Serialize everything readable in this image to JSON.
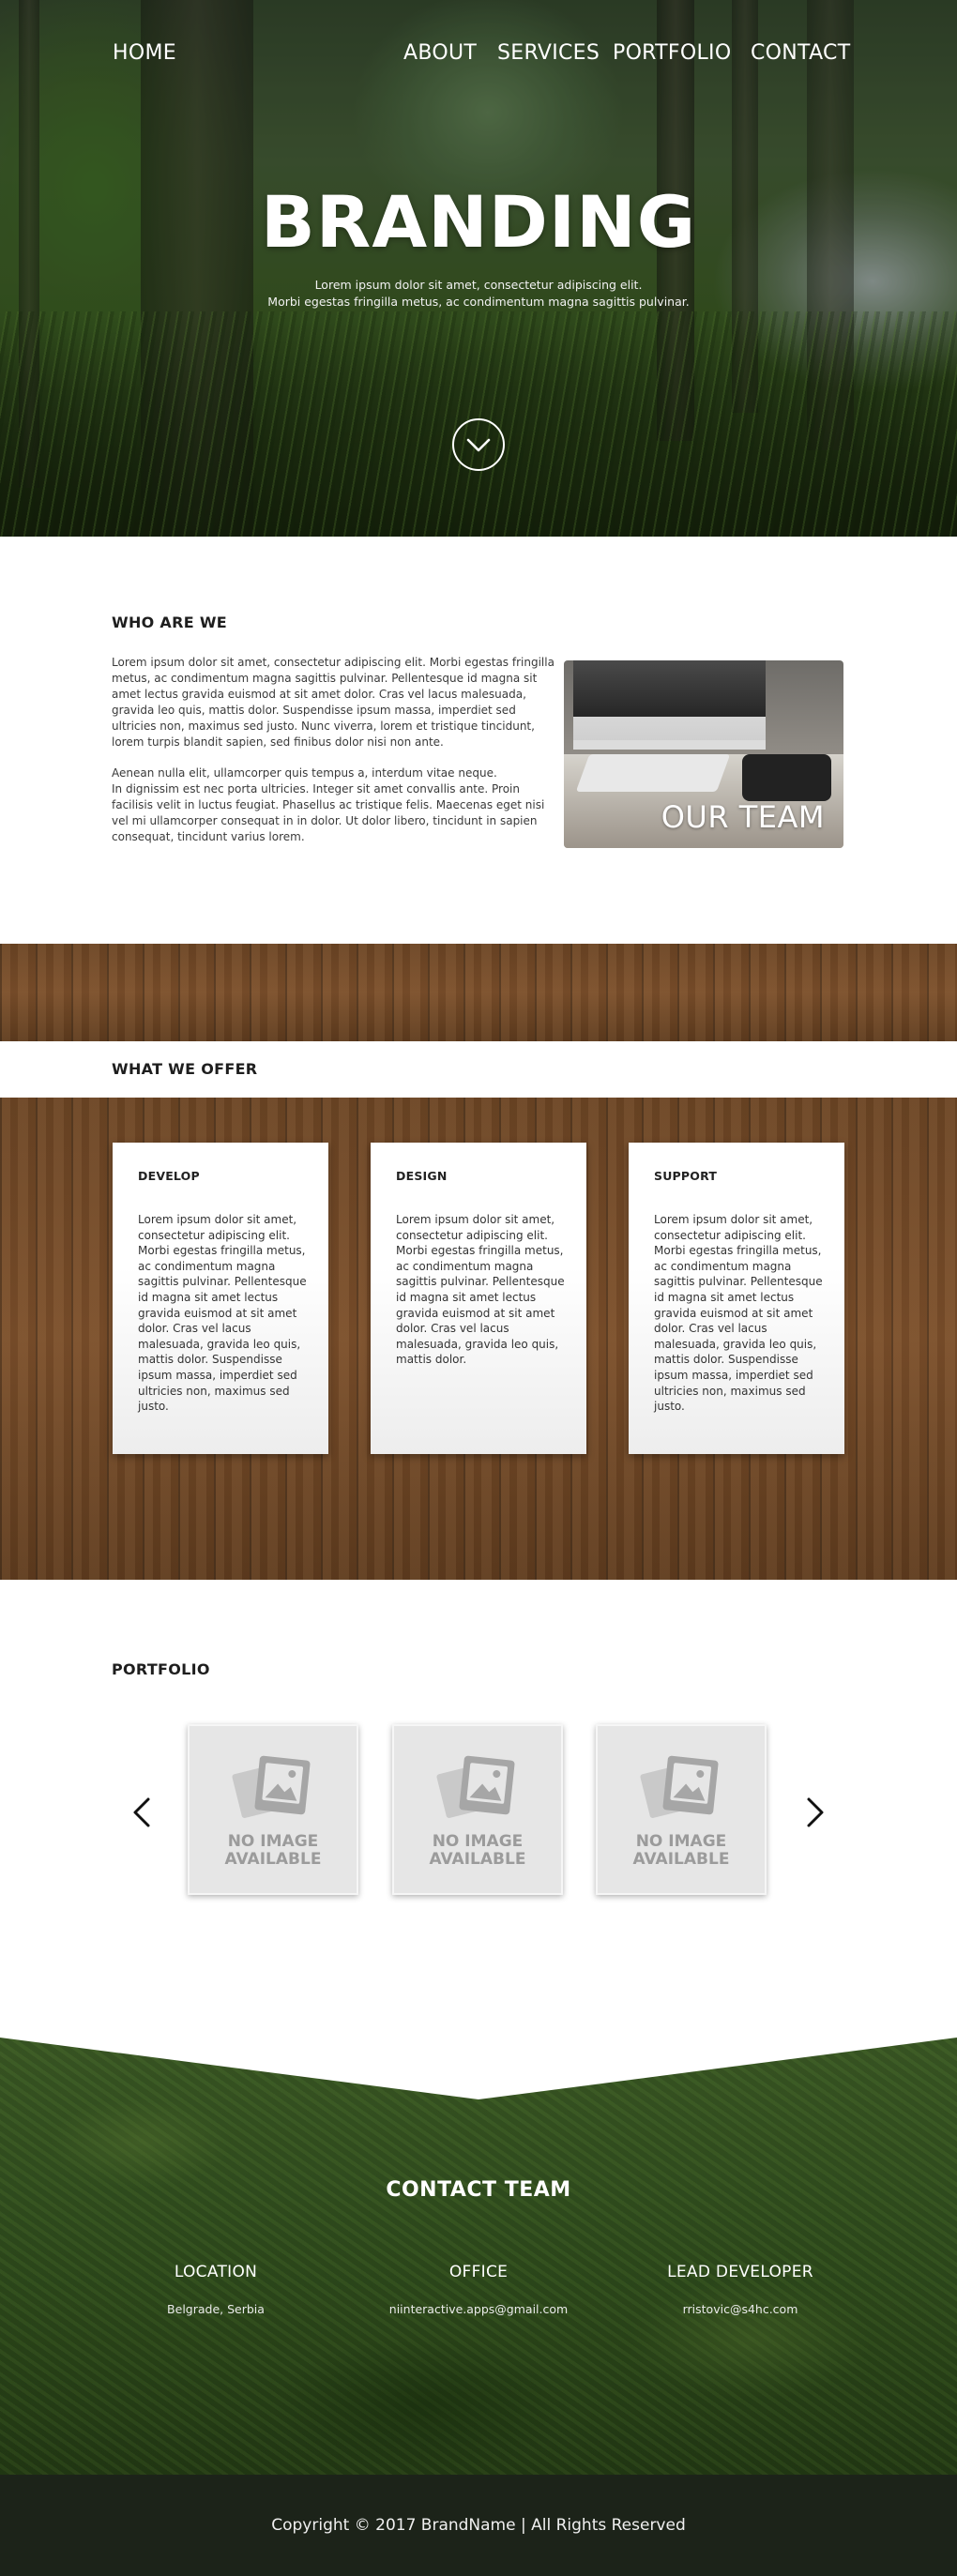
{
  "nav": {
    "home": "HOME",
    "about": "ABOUT",
    "services": "SERVICES",
    "portfolio": "PORTFOLIO",
    "contact": "CONTACT"
  },
  "hero": {
    "title": "BRANDING",
    "subtitle_line1": "Lorem ipsum dolor sit amet, consectetur adipiscing elit.",
    "subtitle_line2": "Morbi egestas fringilla metus, ac condimentum magna sagittis pulvinar.",
    "scroll_icon": "chevron-down-circle-icon"
  },
  "who": {
    "heading": "WHO ARE WE",
    "para1": "Lorem ipsum dolor sit amet, consectetur adipiscing elit. Morbi egestas fringilla\n metus, ac condimentum magna sagittis pulvinar. Pellentesque id magna sit\namet lectus gravida euismod at sit amet dolor. Cras vel lacus malesuada,\ngravida leo quis, mattis dolor. Suspendisse ipsum massa, imperdiet sed\nultricies non, maximus sed justo. Nunc viverra, lorem et tristique tincidunt,\nlorem turpis blandit sapien, sed finibus dolor nisi non ante.",
    "para2": "Aenean nulla elit, ullamcorper quis tempus a, interdum vitae neque.\nIn dignissim est nec porta ultricies. Integer sit amet convallis ante. Proin\nfacilisis velit in luctus feugiat. Phasellus ac tristique felis. Maecenas eget nisi\nvel mi ullamcorper consequat in in dolor. Ut dolor libero, tincidunt in sapien\nconsequat, tincidunt varius lorem.",
    "team_label": "OUR TEAM"
  },
  "offer": {
    "heading": "WHAT WE OFFER",
    "cards": [
      {
        "title": "DEVELOP",
        "body": "Lorem ipsum dolor sit amet, consectetur adipiscing elit. Morbi egestas fringilla metus, ac condimentum magna sagittis pulvinar. Pellentesque id magna sit amet lectus gravida euismod at sit amet dolor. Cras vel lacus malesuada, gravida leo quis, mattis dolor. Suspendisse ipsum massa, imperdiet sed ultricies non, maximus sed justo."
      },
      {
        "title": "DESIGN",
        "body": "Lorem ipsum dolor sit amet, consectetur adipiscing elit. Morbi egestas fringilla metus, ac condimentum magna sagittis pulvinar. Pellentesque id magna sit amet lectus gravida euismod at sit amet dolor. Cras vel lacus malesuada, gravida leo quis, mattis dolor."
      },
      {
        "title": "SUPPORT",
        "body": "Lorem ipsum dolor sit amet, consectetur adipiscing elit. Morbi egestas fringilla metus, ac condimentum magna sagittis pulvinar. Pellentesque id magna sit amet lectus gravida euismod at sit amet dolor. Cras vel lacus malesuada, gravida leo quis, mattis dolor. Suspendisse ipsum massa, imperdiet sed ultricies non, maximus sed justo."
      }
    ]
  },
  "portfolio": {
    "heading": "PORTFOLIO",
    "items": [
      {
        "label": "NO IMAGE\nAVAILABLE"
      },
      {
        "label": "NO IMAGE\nAVAILABLE"
      },
      {
        "label": "NO IMAGE\nAVAILABLE"
      }
    ],
    "prev_icon": "chevron-left-icon",
    "next_icon": "chevron-right-icon"
  },
  "contact": {
    "heading": "CONTACT TEAM",
    "columns": [
      {
        "label": "LOCATION",
        "value": "Belgrade, Serbia"
      },
      {
        "label": "OFFICE",
        "value": "niinteractive.apps@gmail.com"
      },
      {
        "label": "LEAD DEVELOPER",
        "value": "rristovic@s4hc.com"
      }
    ]
  },
  "footer": {
    "copyright": "Copyright © 2017 BrandName | All Rights Reserved"
  },
  "colors": {
    "forest_green": "#3b5a25",
    "wood_brown": "#6b4424",
    "footer_dark": "#1c2319",
    "text_dark": "#2a2a2a"
  }
}
